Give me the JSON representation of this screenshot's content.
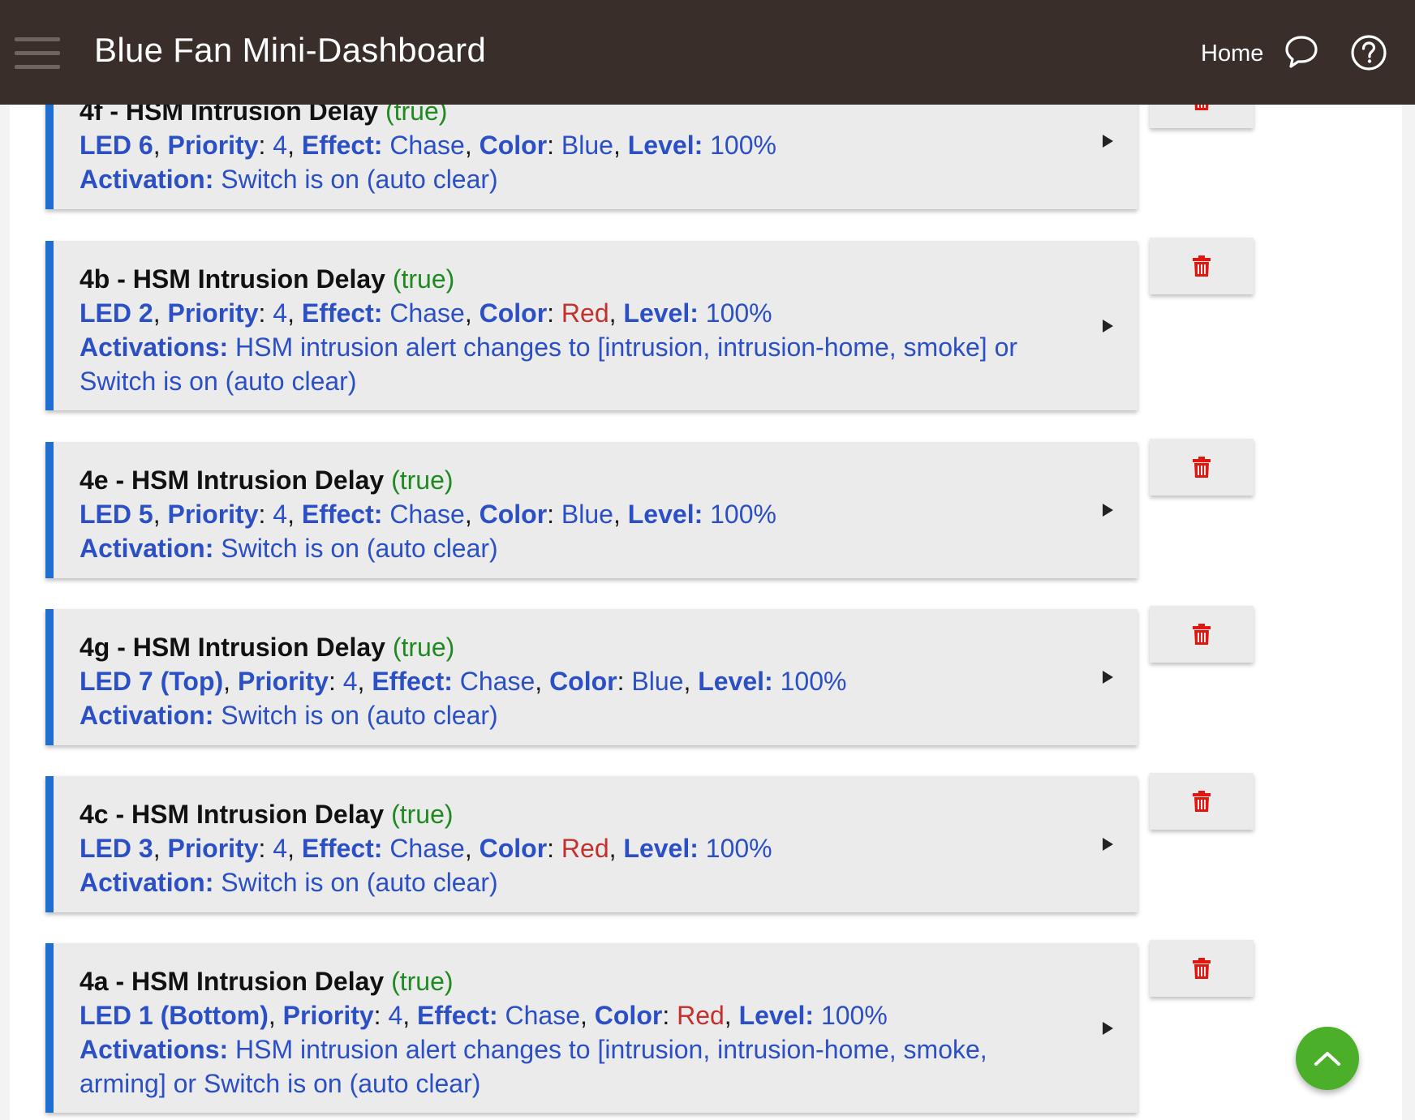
{
  "header": {
    "title": "Blue Fan Mini-Dashboard",
    "home_label": "Home",
    "menu_icon": "hamburger-menu-icon",
    "chat_icon": "chat-bubble-icon",
    "help_icon": "help-circle-icon"
  },
  "colors": {
    "header_bg": "#3a2e2a",
    "accent_blue": "#1f6fd2",
    "label_blue": "#2b4fc4",
    "state_green": "#1f8a1f",
    "red": "#c4302b",
    "fab_green": "#4caf2a"
  },
  "notifications": [
    {
      "name": "4f - HSM Intrusion Delay",
      "state": "(true)",
      "led": "LED 6",
      "priority_label": "Priority",
      "priority": "4",
      "effect_label": "Effect:",
      "effect": "Chase",
      "color_label": "Color",
      "color": "Blue",
      "level_label": "Level:",
      "level": "100%",
      "activation_label": "Activation:",
      "activation": "Switch is on (auto clear)"
    },
    {
      "name": "4b - HSM Intrusion Delay",
      "state": "(true)",
      "led": "LED 2",
      "priority_label": "Priority",
      "priority": "4",
      "effect_label": "Effect:",
      "effect": "Chase",
      "color_label": "Color",
      "color": "Red",
      "level_label": "Level:",
      "level": "100%",
      "activation_label": "Activations:",
      "activation": "HSM intrusion alert changes to [intrusion, intrusion-home, smoke] or Switch is on (auto clear)"
    },
    {
      "name": "4e - HSM Intrusion Delay",
      "state": "(true)",
      "led": "LED 5",
      "priority_label": "Priority",
      "priority": "4",
      "effect_label": "Effect:",
      "effect": "Chase",
      "color_label": "Color",
      "color": "Blue",
      "level_label": "Level:",
      "level": "100%",
      "activation_label": "Activation:",
      "activation": "Switch is on (auto clear)"
    },
    {
      "name": "4g - HSM Intrusion Delay",
      "state": "(true)",
      "led": "LED 7 (Top)",
      "priority_label": "Priority",
      "priority": "4",
      "effect_label": "Effect:",
      "effect": "Chase",
      "color_label": "Color",
      "color": "Blue",
      "level_label": "Level:",
      "level": "100%",
      "activation_label": "Activation:",
      "activation": "Switch is on (auto clear)"
    },
    {
      "name": "4c - HSM Intrusion Delay",
      "state": "(true)",
      "led": "LED 3",
      "priority_label": "Priority",
      "priority": "4",
      "effect_label": "Effect:",
      "effect": "Chase",
      "color_label": "Color",
      "color": "Red",
      "level_label": "Level:",
      "level": "100%",
      "activation_label": "Activation:",
      "activation": "Switch is on (auto clear)"
    },
    {
      "name": "4a - HSM Intrusion Delay",
      "state": "(true)",
      "led": "LED 1 (Bottom)",
      "priority_label": "Priority",
      "priority": "4",
      "effect_label": "Effect:",
      "effect": "Chase",
      "color_label": "Color",
      "color": "Red",
      "level_label": "Level:",
      "level": "100%",
      "activation_label": "Activations:",
      "activation": "HSM intrusion alert changes to [intrusion, intrusion-home, smoke, arming] or Switch is on (auto clear)"
    }
  ],
  "icons": {
    "expand": "expand-arrow-icon",
    "delete": "trash-icon",
    "scroll_top": "chevron-up-icon"
  }
}
